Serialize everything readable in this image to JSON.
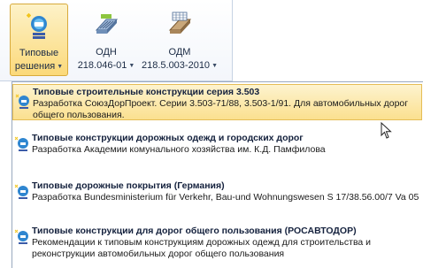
{
  "ribbon": {
    "buttons": [
      {
        "line1": "Типовые",
        "line2": "решения",
        "icon": "standard-solutions-icon",
        "active": true
      },
      {
        "line1": "ОДН",
        "line2": "218.046-01",
        "icon": "odn-doc-icon",
        "active": false
      },
      {
        "line1": "ОДМ",
        "line2": "218.5.003-2010",
        "icon": "odm-doc-icon",
        "active": false
      }
    ]
  },
  "menu": {
    "items": [
      {
        "title": "Типовые строительные конструкции серия 3.503",
        "desc": "Разработка СоюзДорПроект. Серии 3.503-71/88, 3.503-1/91.  Для автомобильных дорог общего пользования.",
        "highlighted": true
      },
      {
        "title": "Типовые конструкции дорожных одежд и городских дорог",
        "desc": "Разработка Академии комунального хозяйства им. К.Д. Памфилова",
        "highlighted": false
      },
      {
        "title": "Типовые дорожные покрытия (Германия)",
        "desc": "Разработка Bundesministerium für Verkehr, Bau-und Wohnungswesen S 17/38.56.00/7 Va 05",
        "highlighted": false
      },
      {
        "title": "Типовые конструкции для дорог общего пользования (РОСАВТОДОР)",
        "desc": "Рекомендации к типовым конструкциям дорожных одежд для строительства и реконструкции автомобильных дорог общего пользования",
        "highlighted": false
      }
    ]
  },
  "colors": {
    "highlight_top": "#fdf3cf",
    "highlight_bottom": "#fbe08f",
    "highlight_border": "#e5bd55",
    "icon_blue": "#2f86d0"
  }
}
